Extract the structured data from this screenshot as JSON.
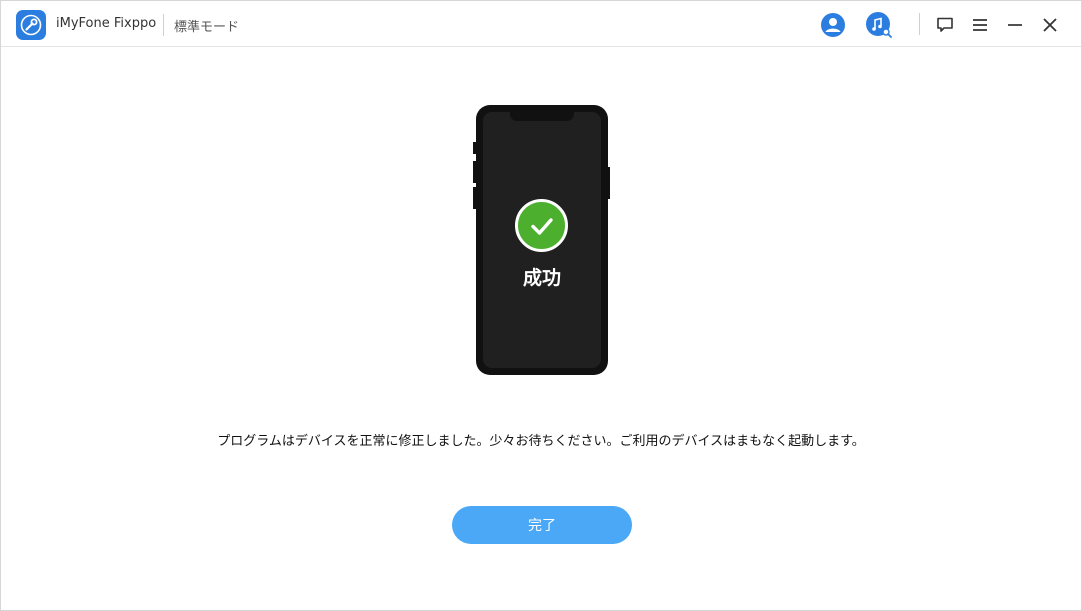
{
  "titlebar": {
    "app_name": "iMyFone Fixppo",
    "mode": "標準モード",
    "icons": {
      "logo": "wrench-logo-icon",
      "account": "user-account-icon",
      "music_search": "music-search-icon",
      "feedback": "chat-feedback-icon",
      "menu": "hamburger-menu-icon",
      "minimize": "minimize-icon",
      "close": "close-icon"
    }
  },
  "main": {
    "status_label": "成功",
    "message": "プログラムはデバイスを正常に修正しました。少々お待ちください。ご利用のデバイスはまもなく起動します。",
    "done_button": "完了"
  },
  "colors": {
    "accent": "#4aa8f7",
    "success": "#4caf2e",
    "phone_body": "#111111",
    "icon_blue": "#2b7de0"
  }
}
